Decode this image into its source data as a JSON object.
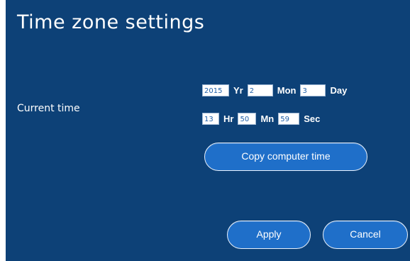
{
  "title": "Time zone settings",
  "current_time": {
    "label": "Current time",
    "year": "2015",
    "year_unit": "Yr",
    "month": "2",
    "month_unit": "Mon",
    "day": "3",
    "day_unit": "Day",
    "hour": "13",
    "hour_unit": "Hr",
    "minute": "50",
    "minute_unit": "Mn",
    "second": "59",
    "second_unit": "Sec"
  },
  "buttons": {
    "copy": "Copy computer time",
    "apply": "Apply",
    "cancel": "Cancel"
  },
  "colors": {
    "panel_background": "#0d4177",
    "button_fill": "#1f6fc9",
    "field_text": "#1f5fa8"
  }
}
